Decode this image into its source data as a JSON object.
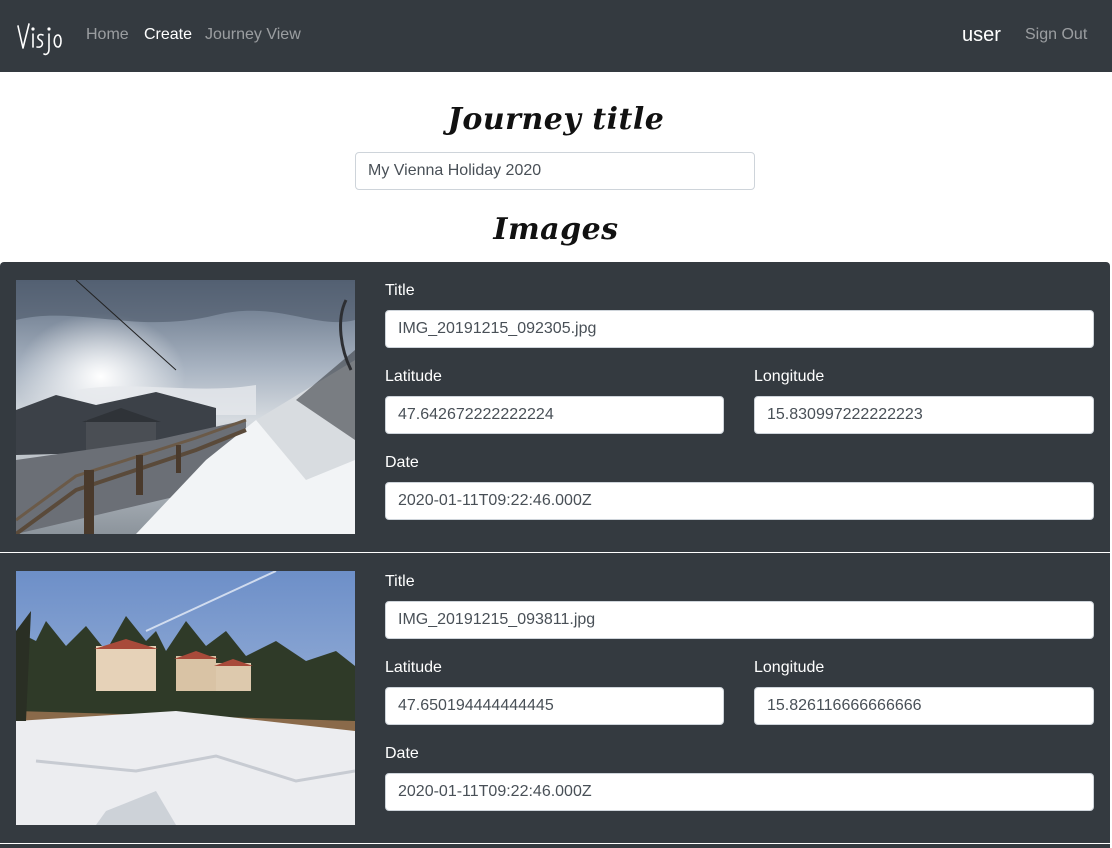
{
  "navbar": {
    "brand": "Visjo",
    "links": [
      {
        "label": "Home"
      },
      {
        "label": "Create"
      },
      {
        "label": "Journey View"
      }
    ],
    "user": "user",
    "sign_out": "Sign Out"
  },
  "journey": {
    "heading": "Journey title",
    "title_value": "My Vienna Holiday 2020"
  },
  "images": {
    "heading": "Images",
    "title_label": "Title",
    "latitude_label": "Latitude",
    "longitude_label": "Longitude",
    "date_label": "Date",
    "items": [
      {
        "title": "IMG_20191215_092305.jpg",
        "latitude": "47.642672222222224",
        "longitude": "15.830997222222223",
        "date": "2020-01-11T09:22:46.000Z"
      },
      {
        "title": "IMG_20191215_093811.jpg",
        "latitude": "47.650194444444445",
        "longitude": "15.826116666666666",
        "date": "2020-01-11T09:22:46.000Z"
      }
    ]
  },
  "colors": {
    "navbar_bg": "#343a40",
    "card_bg": "#343a40",
    "active_link": "#ffffff",
    "inactive_link": "rgba(255,255,255,0.5)"
  }
}
